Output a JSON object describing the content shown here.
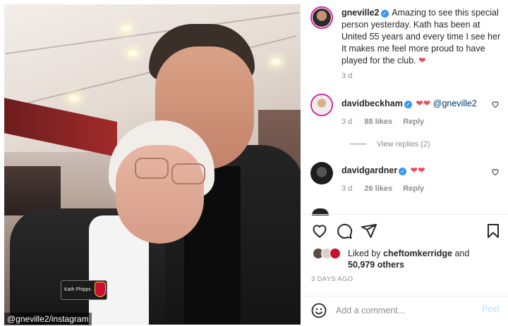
{
  "photo": {
    "credit": "@gneville2/instagram",
    "badge_text": "Kath Phipps"
  },
  "post": {
    "author": "gneville2",
    "caption": "Amazing to see this special person yesterday. Kath has been at United 55 years and every time I see her It makes me feel more proud to have played for the club.",
    "caption_emoji": "❤",
    "caption_age": "3 d"
  },
  "comments": [
    {
      "username": "davidbeckham",
      "emoji": "❤❤",
      "mention": "@gneville2",
      "age": "3 d",
      "likes": "88 likes",
      "reply": "Reply",
      "view_replies": "View replies (2)"
    },
    {
      "username": "davidgardner",
      "emoji": "❤❤",
      "age": "3 d",
      "likes": "26 likes",
      "reply": "Reply"
    }
  ],
  "likes": {
    "prefix": "Liked by",
    "user": "cheftomkerridge",
    "and": "and",
    "others": "50,979 others"
  },
  "timestamp": "3 DAYS AGO",
  "composer": {
    "placeholder": "Add a comment...",
    "post_label": "Post"
  },
  "colors": {
    "verified": "#3897f0",
    "heart": "#ed4956",
    "post_disabled": "#b2dffc",
    "muted": "#8e8e8e"
  }
}
